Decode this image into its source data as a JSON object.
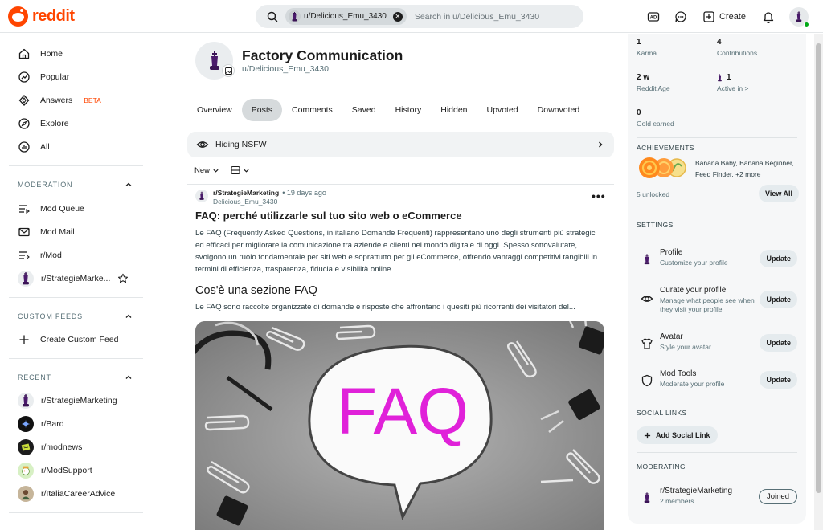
{
  "header": {
    "logo_text": "reddit",
    "search_chip": "u/Delicious_Emu_3430",
    "search_placeholder": "Search in u/Delicious_Emu_3430",
    "create_label": "Create"
  },
  "sidebar": {
    "nav": [
      {
        "label": "Home",
        "icon": "home-icon"
      },
      {
        "label": "Popular",
        "icon": "popular-icon"
      },
      {
        "label": "Answers",
        "icon": "answers-icon",
        "badge": "BETA"
      },
      {
        "label": "Explore",
        "icon": "explore-icon"
      },
      {
        "label": "All",
        "icon": "all-icon"
      }
    ],
    "moderation": {
      "title": "MODERATION",
      "items": [
        {
          "label": "Mod Queue",
          "icon": "mod-queue-icon"
        },
        {
          "label": "Mod Mail",
          "icon": "mod-mail-icon"
        },
        {
          "label": "r/Mod",
          "icon": "r-mod-icon"
        },
        {
          "label": "r/StrategieMarke...",
          "icon": "chess-king-icon"
        }
      ]
    },
    "custom_feeds": {
      "title": "CUSTOM FEEDS",
      "create_label": "Create Custom Feed"
    },
    "recent": {
      "title": "RECENT",
      "items": [
        {
          "label": "r/StrategieMarketing"
        },
        {
          "label": "r/Bard"
        },
        {
          "label": "r/modnews"
        },
        {
          "label": "r/ModSupport"
        },
        {
          "label": "r/ItaliaCareerAdvice"
        }
      ]
    }
  },
  "profile": {
    "title": "Factory Communication",
    "handle": "u/Delicious_Emu_3430",
    "tabs": [
      "Overview",
      "Posts",
      "Comments",
      "Saved",
      "History",
      "Hidden",
      "Upvoted",
      "Downvoted"
    ],
    "active_tab": "Posts"
  },
  "feed": {
    "nsfw_label": "Hiding NSFW",
    "sort_label": "New"
  },
  "post": {
    "subreddit": "r/StrategieMarketing",
    "time": "• 19 days ago",
    "author": "Delicious_Emu_3430",
    "title": "FAQ: perché utilizzarle sul tuo sito web o eCommerce",
    "body": "Le FAQ (Frequently Asked Questions, in italiano Domande Frequenti) rappresentano uno degli strumenti più strategici ed efficaci per migliorare la comunicazione tra aziende e clienti nel mondo digitale di oggi. Spesso sottovalutate, svolgono un ruolo fondamentale per siti web e soprattutto per gli eCommerce, offrendo vantaggi competitivi tangibili in termini di efficienza, trasparenza, fiducia e visibilità online.",
    "heading": "Cos'è una sezione FAQ",
    "paragraph2": "Le FAQ sono raccolte organizzate di domande e risposte che affrontano i quesiti più ricorrenti dei visitatori del...",
    "image_text": "FAQ",
    "more_label": "•••"
  },
  "right": {
    "stats": [
      {
        "num": "1",
        "label": "Karma"
      },
      {
        "num": "4",
        "label": "Contributions"
      },
      {
        "num": "2 w",
        "label": "Reddit Age"
      },
      {
        "num": "1",
        "label": "Active in >"
      },
      {
        "num": "0",
        "label": "Gold earned"
      }
    ],
    "achievements": {
      "title": "ACHIEVEMENTS",
      "text": "Banana Baby, Banana Beginner, Feed Finder, +2 more",
      "unlocked": "5 unlocked",
      "view_all": "View All"
    },
    "settings": {
      "title": "SETTINGS",
      "items": [
        {
          "title": "Profile",
          "sub": "Customize your profile",
          "btn": "Update"
        },
        {
          "title": "Curate your profile",
          "sub": "Manage what people see when they visit your profile",
          "btn": "Update"
        },
        {
          "title": "Avatar",
          "sub": "Style your avatar",
          "btn": "Update"
        },
        {
          "title": "Mod Tools",
          "sub": "Moderate your profile",
          "btn": "Update"
        }
      ]
    },
    "social": {
      "title": "SOCIAL LINKS",
      "add_label": "Add Social Link"
    },
    "moderating": {
      "title": "MODERATING",
      "sub": "r/StrategieMarketing",
      "members": "2 members",
      "joined": "Joined"
    }
  },
  "colors": {
    "brand": "#ff4500",
    "active_tab": "#d6dadc",
    "panel": "#f6f7f8"
  }
}
